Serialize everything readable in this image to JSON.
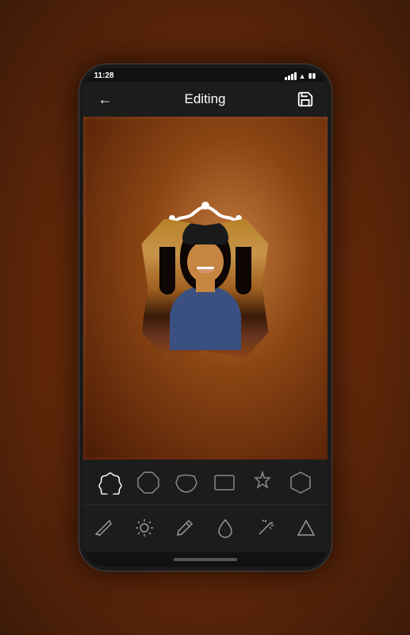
{
  "statusBar": {
    "time": "11:28",
    "batteryIcon": "🔋",
    "wifiIcon": "📶"
  },
  "appBar": {
    "title": "Editing",
    "backLabel": "←",
    "saveLabel": "💾"
  },
  "shapes": [
    {
      "id": "ornate",
      "label": "ornate-shape",
      "active": true
    },
    {
      "id": "octagon",
      "label": "octagon-shape",
      "active": false
    },
    {
      "id": "fancy-rect",
      "label": "fancy-rect-shape",
      "active": false
    },
    {
      "id": "rect",
      "label": "rect-shape",
      "active": false
    },
    {
      "id": "star",
      "label": "star-shape",
      "active": false
    },
    {
      "id": "hexagon",
      "label": "hexagon-shape",
      "active": false
    }
  ],
  "tools": [
    {
      "id": "eraser",
      "label": "eraser-tool"
    },
    {
      "id": "brightness",
      "label": "brightness-tool"
    },
    {
      "id": "brush",
      "label": "brush-tool"
    },
    {
      "id": "color",
      "label": "color-tool"
    },
    {
      "id": "magic",
      "label": "magic-tool"
    },
    {
      "id": "triangle",
      "label": "triangle-tool"
    }
  ],
  "colors": {
    "background": "#1c1c1c",
    "accent": "#ffffff",
    "frameColor": "#ffffff"
  }
}
